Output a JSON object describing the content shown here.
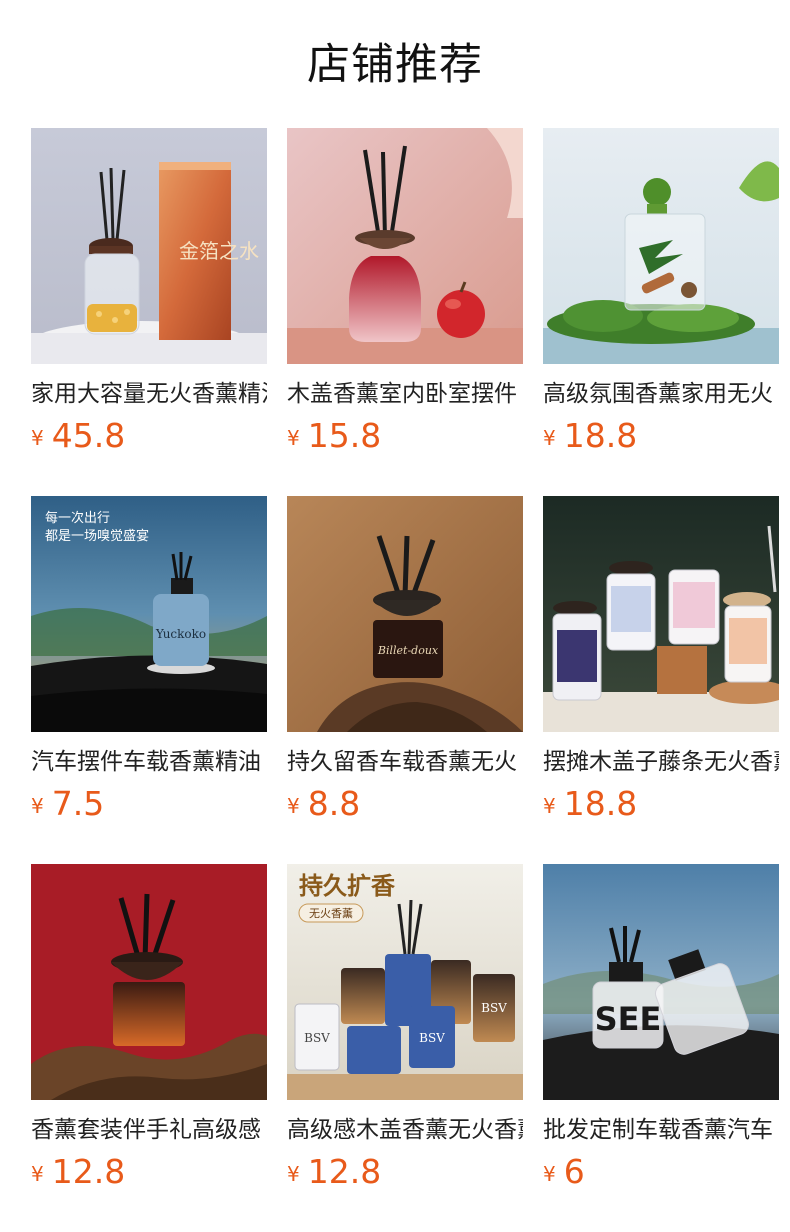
{
  "page": {
    "title": "店铺推荐"
  },
  "currency_symbol": "¥",
  "colors": {
    "price": "#e85a1a",
    "title": "#111111",
    "name": "#222222"
  },
  "products": [
    {
      "name": "家用大容量无火香薰精油",
      "price": "45.8",
      "image_icon": "reed-diffuser-gold-flakes-with-box-image"
    },
    {
      "name": "木盖香薰室内卧室摆件",
      "price": "15.8",
      "image_icon": "red-reed-diffuser-with-apple-image"
    },
    {
      "name": "高级氛围香薰家用无火",
      "price": "18.8",
      "image_icon": "green-cap-diffuser-on-moss-image"
    },
    {
      "name": "汽车摆件车载香薰精油",
      "price": "7.5",
      "image_icon": "car-dashboard-blue-diffuser-image"
    },
    {
      "name": "持久留香车载香薰无火",
      "price": "8.8",
      "image_icon": "dark-diffuser-on-driftwood-image"
    },
    {
      "name": "摆摊木盖子藤条无火香薰",
      "price": "18.8",
      "image_icon": "anime-print-diffuser-set-image"
    },
    {
      "name": "香薰套装伴手礼高级感",
      "price": "12.8",
      "image_icon": "amber-diffuser-on-red-background-image"
    },
    {
      "name": "高级感木盖香薰无火香薰",
      "price": "12.8",
      "image_icon": "bsv-diffuser-collection-image"
    },
    {
      "name": "批发定制车载香薰汽车",
      "price": "6",
      "image_icon": "clear-letter-bottles-car-image"
    }
  ],
  "image_texts": {
    "p1_box": "金箔之水",
    "p4_line1": "每一次出行",
    "p4_line2": "都是一场嗅觉盛宴",
    "p4_brand": "Yuckoko",
    "p5_label": "Billet-doux",
    "p8_headline": "持久扩香",
    "p8_tag": "无火香薰",
    "p8_brand": "BSV",
    "p9_letters": "SEE"
  }
}
